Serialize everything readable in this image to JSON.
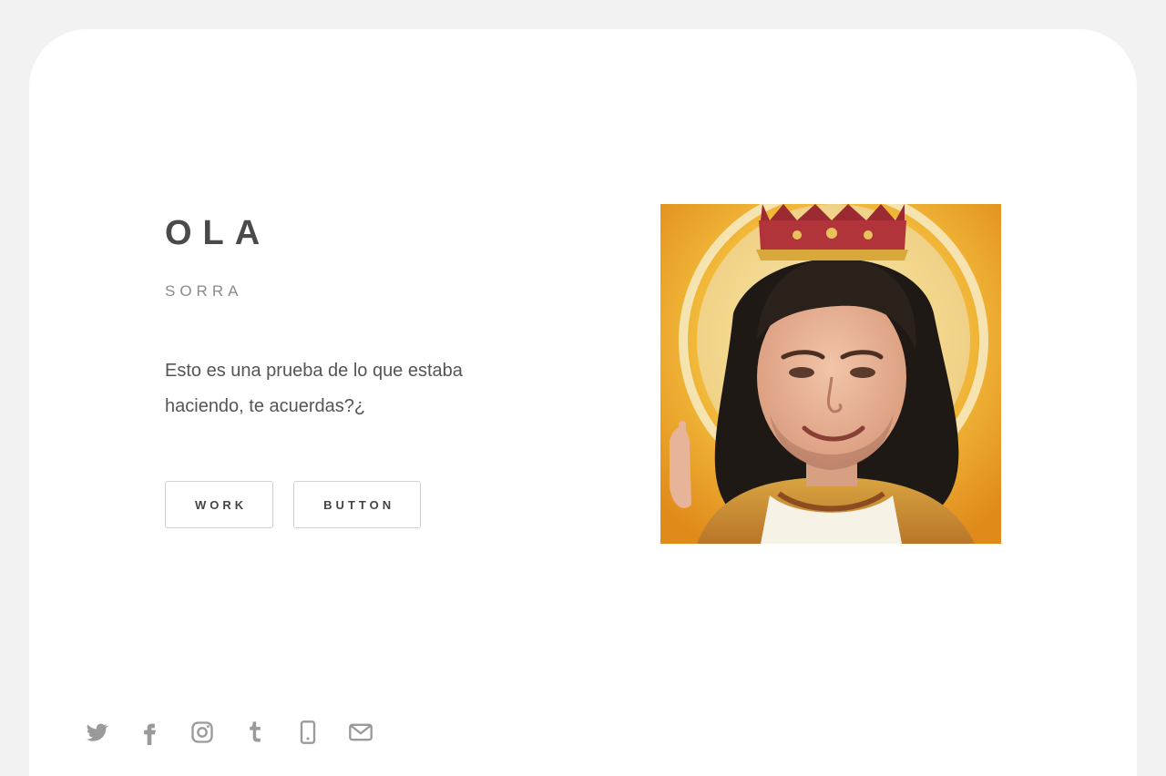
{
  "hero": {
    "title": "OLA",
    "subtitle": "SORRA",
    "description": "Esto es una prueba de lo que estaba haciendo, te acuerdas?¿",
    "buttons": {
      "work": "WORK",
      "button": "BUTTON"
    }
  },
  "social_icons": [
    "twitter-icon",
    "facebook-icon",
    "instagram-icon",
    "tumblr-icon",
    "phone-icon",
    "email-icon"
  ],
  "colors": {
    "page_background": "#f2f2f2",
    "card_background": "#ffffff",
    "title": "#4a4a4a",
    "muted": "#8a8a8a",
    "button_border": "#cfcfcf"
  }
}
